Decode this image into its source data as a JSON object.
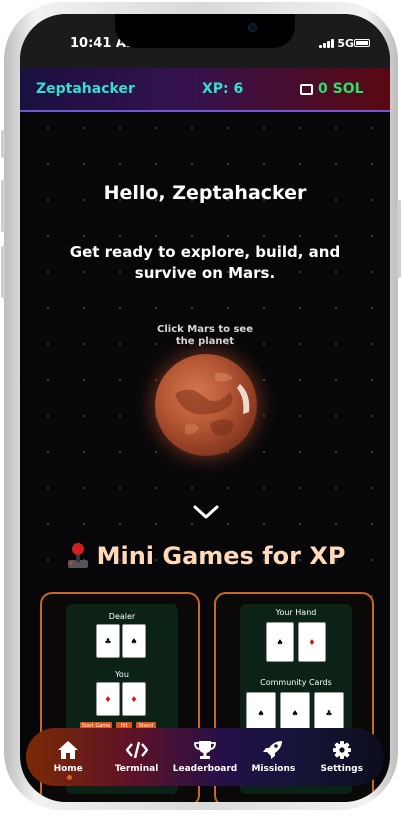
{
  "status": {
    "time": "10:41 AM",
    "network": "5G"
  },
  "header": {
    "username": "Zeptahacker",
    "xp": "XP: 6",
    "balance": "0 SOL"
  },
  "main": {
    "greeting": "Hello, Zeptahacker",
    "subtitle": "Get ready to explore, build, and survive on Mars.",
    "mars_hint": "Click Mars to see the planet",
    "games_title": "Mini Games for XP"
  },
  "game1": {
    "dealer_label": "Dealer",
    "you_label": "You",
    "buttons": [
      "Start Game",
      "Hit",
      "Stand"
    ]
  },
  "game2": {
    "hand_label": "Your Hand",
    "community_label": "Community Cards"
  },
  "nav": {
    "items": [
      {
        "label": "Home",
        "icon": "home-icon"
      },
      {
        "label": "Terminal",
        "icon": "code-icon"
      },
      {
        "label": "Leaderboard",
        "icon": "trophy-icon"
      },
      {
        "label": "Missions",
        "icon": "rocket-icon"
      },
      {
        "label": "Settings",
        "icon": "gear-icon"
      }
    ]
  },
  "colors": {
    "accent_teal": "#35e0d0",
    "sol_green": "#2de06a",
    "card_border": "#c96820"
  }
}
